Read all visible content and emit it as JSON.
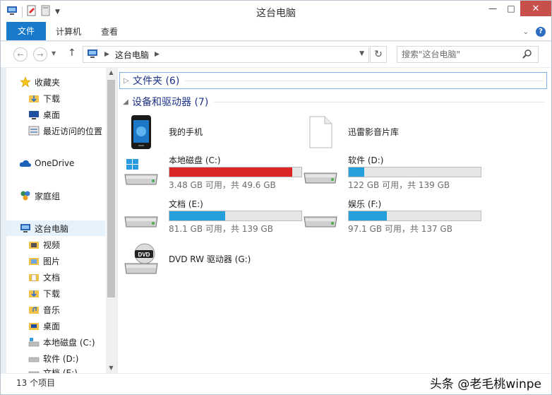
{
  "window": {
    "title": "这台电脑"
  },
  "ribbon": {
    "tabs": [
      "文件",
      "计算机",
      "查看"
    ]
  },
  "address": {
    "crumb": "这台电脑"
  },
  "search": {
    "placeholder": "搜索\"这台电脑\""
  },
  "nav": {
    "items": [
      {
        "label": "收藏夹",
        "icon": "favorites-star-icon"
      },
      {
        "label": "下载",
        "icon": "downloads-folder-icon"
      },
      {
        "label": "桌面",
        "icon": "desktop-icon"
      },
      {
        "label": "最近访问的位置",
        "icon": "recent-places-icon"
      },
      {
        "label": "OneDrive",
        "icon": "onedrive-cloud-icon"
      },
      {
        "label": "家庭组",
        "icon": "homegroup-icon"
      },
      {
        "label": "这台电脑",
        "icon": "this-pc-icon"
      },
      {
        "label": "视频",
        "icon": "videos-folder-icon"
      },
      {
        "label": "图片",
        "icon": "pictures-folder-icon"
      },
      {
        "label": "文档",
        "icon": "documents-folder-icon"
      },
      {
        "label": "下载",
        "icon": "downloads-folder-icon"
      },
      {
        "label": "音乐",
        "icon": "music-folder-icon"
      },
      {
        "label": "桌面",
        "icon": "desktop-folder-icon"
      },
      {
        "label": "本地磁盘 (C:)",
        "icon": "drive-c-icon"
      },
      {
        "label": "软件 (D:)",
        "icon": "drive-d-icon"
      },
      {
        "label": "文档 (E:)",
        "icon": "drive-e-icon"
      }
    ]
  },
  "groups": {
    "folders": {
      "title": "文件夹 (6)"
    },
    "devices": {
      "title": "设备和驱动器 (7)"
    }
  },
  "devices": {
    "phone": {
      "name": "我的手机"
    },
    "xunlei": {
      "name": "迅雷影音片库"
    },
    "drive_c": {
      "name": "本地磁盘 (C:)",
      "info": "3.48 GB 可用，共 49.6 GB",
      "used_fraction": 0.93
    },
    "drive_d": {
      "name": "软件 (D:)",
      "info": "122 GB 可用，共 139 GB",
      "used_fraction": 0.12
    },
    "drive_e": {
      "name": "文档 (E:)",
      "info": "81.1 GB 可用，共 139 GB",
      "used_fraction": 0.42
    },
    "drive_f": {
      "name": "娱乐 (F:)",
      "info": "97.1 GB 可用，共 137 GB",
      "used_fraction": 0.29
    },
    "dvd": {
      "name": "DVD RW 驱动器 (G:)"
    }
  },
  "status": {
    "count": "13 个项目"
  },
  "watermark": {
    "text": "头条 @老毛桃winpe"
  },
  "colors": {
    "accent": "#1979ca",
    "bar_normal": "#26a0da",
    "bar_full": "#da2626",
    "close": "#c7504b"
  }
}
